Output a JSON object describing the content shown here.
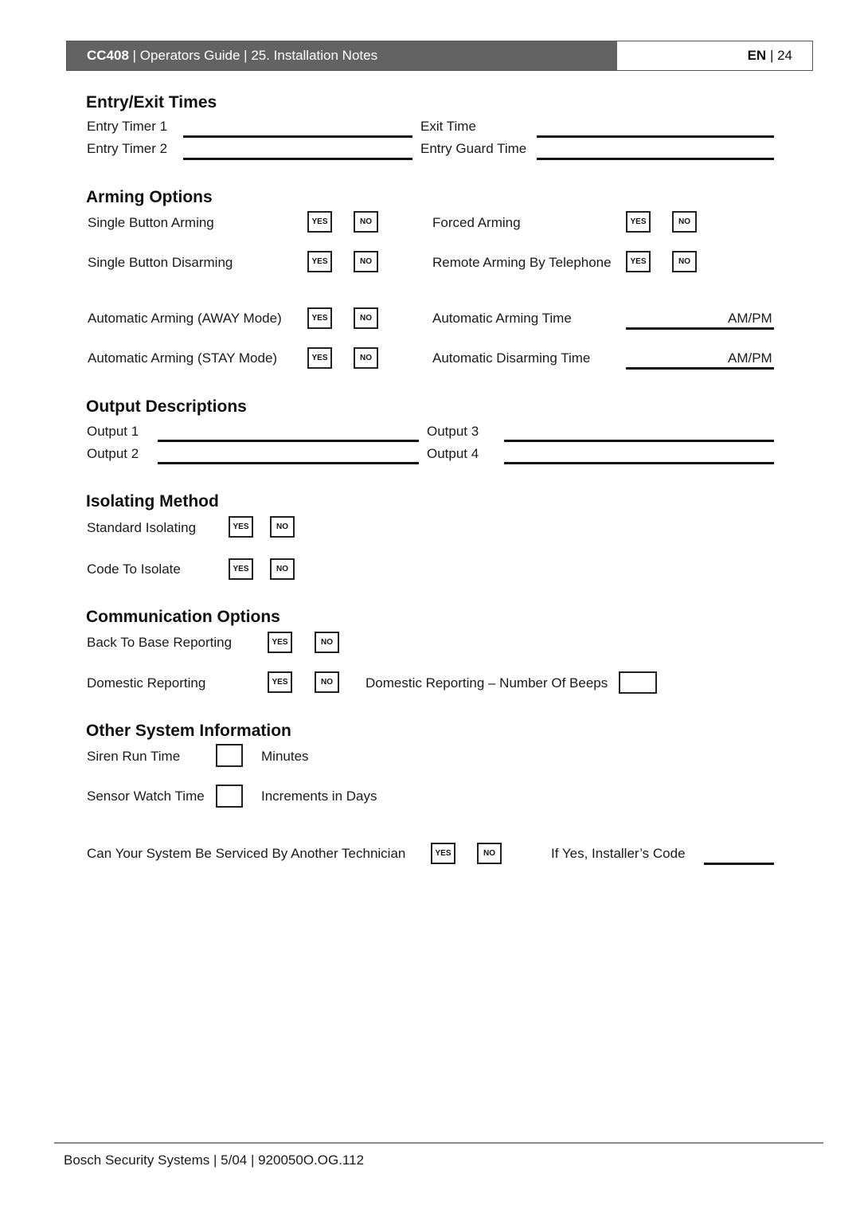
{
  "header": {
    "product": "CC408",
    "title_rest": " | Operators Guide | 25.  Installation Notes",
    "lang": "EN",
    "page_sep": " | 24"
  },
  "sections": {
    "entry_exit": {
      "heading": "Entry/Exit Times",
      "entry_timer_1": "Entry Timer 1",
      "entry_timer_2": "Entry Timer 2",
      "exit_time": "Exit Time",
      "entry_guard_time": "Entry Guard Time"
    },
    "arming": {
      "heading": "Arming Options",
      "single_button_arming": "Single Button Arming",
      "single_button_disarming": "Single Button Disarming",
      "auto_arming_away": "Automatic Arming (AWAY Mode)",
      "auto_arming_stay": "Automatic Arming (STAY Mode)",
      "forced_arming": "Forced Arming",
      "remote_arming_telephone": "Remote Arming By Telephone",
      "auto_arming_time": "Automatic Arming Time",
      "auto_disarming_time": "Automatic Disarming Time",
      "ampm": "AM/PM"
    },
    "outputs": {
      "heading": "Output Descriptions",
      "output_1": "Output 1",
      "output_2": "Output 2",
      "output_3": "Output 3",
      "output_4": "Output 4"
    },
    "isolating": {
      "heading": "Isolating Method",
      "standard_isolating": "Standard Isolating",
      "code_to_isolate": "Code To Isolate"
    },
    "communication": {
      "heading": "Communication Options",
      "back_to_base": "Back To Base Reporting",
      "domestic_reporting": "Domestic Reporting",
      "domestic_beeps": "Domestic Reporting – Number Of Beeps"
    },
    "other": {
      "heading": "Other System Information",
      "siren_run_time": "Siren Run Time",
      "minutes": "Minutes",
      "sensor_watch_time": "Sensor Watch Time",
      "increments_days": "Increments in Days",
      "serviced_by_other": "Can Your System Be Serviced By Another Technician",
      "installer_code": "If Yes, Installer’s Code"
    }
  },
  "choices": {
    "yes": "YES",
    "no": "NO"
  },
  "footer": {
    "text": "Bosch Security Systems | 5/04 | 920050O.OG.112"
  }
}
